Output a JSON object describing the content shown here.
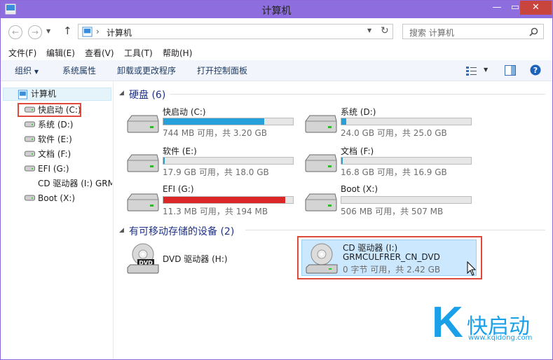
{
  "window": {
    "title": "计算机"
  },
  "address": {
    "crumb": "计算机"
  },
  "search": {
    "placeholder": "搜索 计算机"
  },
  "menu": [
    "文件(F)",
    "编辑(E)",
    "查看(V)",
    "工具(T)",
    "帮助(H)"
  ],
  "toolbar": {
    "organize": "组织",
    "system_props": "系统属性",
    "uninstall": "卸载或更改程序",
    "control_panel": "打开控制面板"
  },
  "nav": {
    "root": "计算机",
    "items": [
      "快启动 (C:)",
      "系统 (D:)",
      "软件 (E:)",
      "文档 (F:)",
      "EFI (G:)",
      "CD 驱动器 (I:) GRM",
      "Boot (X:)"
    ]
  },
  "groups": {
    "hard_disks": "硬盘 (6)",
    "removable": "有可移动存储的设备 (2)"
  },
  "drives": [
    {
      "label": "快启动 (C:)",
      "space": "744 MB 可用，共 3.20 GB",
      "used": 0.78,
      "color": "#26a0da"
    },
    {
      "label": "系统 (D:)",
      "space": "24.0 GB 可用，共 25.0 GB",
      "used": 0.04,
      "color": "#26a0da"
    },
    {
      "label": "软件 (E:)",
      "space": "17.9 GB 可用，共 18.0 GB",
      "used": 0.01,
      "color": "#26a0da"
    },
    {
      "label": "文档 (F:)",
      "space": "16.8 GB 可用，共 16.9 GB",
      "used": 0.01,
      "color": "#26a0da"
    },
    {
      "label": "EFI (G:)",
      "space": "11.3 MB 可用，共 194 MB",
      "used": 0.94,
      "color": "#da2626"
    },
    {
      "label": "Boot (X:)",
      "space": "506 MB 可用，共 507 MB",
      "used": 0.0,
      "color": "#26a0da"
    }
  ],
  "removable": [
    {
      "label": "DVD 驱动器 (H:)"
    },
    {
      "label": "CD 驱动器 (I:)",
      "volume": "GRMCULFRER_CN_DVD",
      "space": "0 字节 可用，共 2.42 GB"
    }
  ],
  "logo": {
    "letter": "K",
    "text": "快启动",
    "url": "www.kqidong.com"
  }
}
